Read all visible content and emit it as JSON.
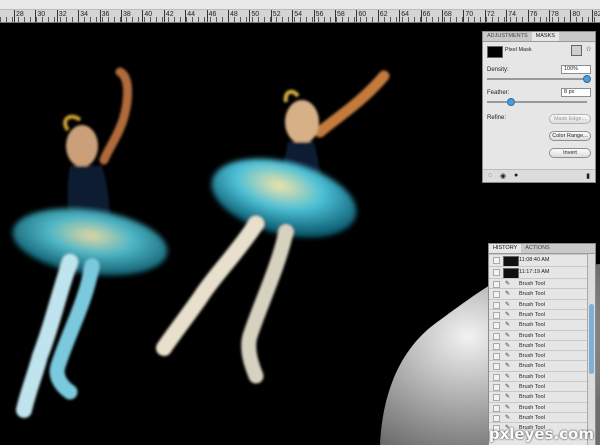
{
  "ruler": {
    "ticks": [
      "28",
      "30",
      "32",
      "34",
      "36",
      "38",
      "40",
      "42",
      "44",
      "46",
      "48",
      "50",
      "52",
      "54",
      "56",
      "58",
      "60",
      "62",
      "64",
      "66",
      "68",
      "70",
      "72",
      "74",
      "76",
      "78",
      "80",
      "82"
    ]
  },
  "masks_panel": {
    "tabs": [
      "ADJUSTMENTS",
      "MASKS"
    ],
    "active_tab": "MASKS",
    "mask_type": "Pixel Mask",
    "density_label": "Density:",
    "density_value": "100%",
    "density_level": 1.0,
    "feather_label": "Feather:",
    "feather_value": "8 px",
    "refine_label": "Refine:",
    "mask_edge_button": "Mask Edge...",
    "color_range_button": "Color Range...",
    "invert_button": "Invert"
  },
  "history_panel": {
    "tabs": [
      "HISTORY",
      "ACTIONS"
    ],
    "active_tab": "HISTORY",
    "snapshots": [
      "11:08:40 AM",
      "11:17:19 AM"
    ],
    "states": [
      "Brush Tool",
      "Brush Tool",
      "Brush Tool",
      "Brush Tool",
      "Brush Tool",
      "Brush Tool",
      "Brush Tool",
      "Brush Tool",
      "Brush Tool",
      "Brush Tool",
      "Brush Tool",
      "Brush Tool",
      "Brush Tool",
      "Brush Tool",
      "Brush Tool"
    ]
  },
  "watermark": {
    "text": "pxleyes.com"
  },
  "colors": {
    "panel_bg": "#e6e6e6",
    "accent": "#4d9bd8",
    "canvas_bg": "#000000"
  }
}
